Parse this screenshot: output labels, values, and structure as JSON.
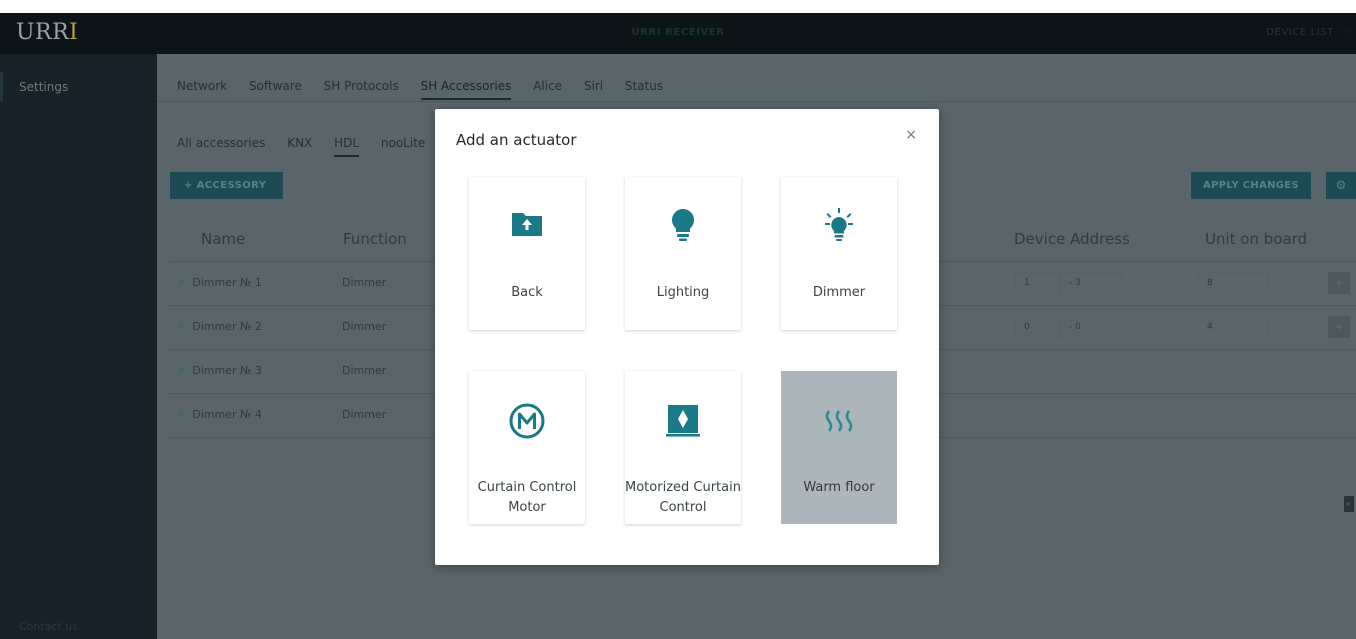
{
  "app": {
    "logo_main": "URR",
    "logo_accent": "I",
    "header_title": "URRI RECEIVER",
    "device_list_label": "DEVICE LIST",
    "device_list_caret": "⌵"
  },
  "sidebar": {
    "items": [
      {
        "label": "Settings"
      }
    ],
    "contact": "Contact us"
  },
  "tabs": [
    {
      "label": "Network"
    },
    {
      "label": "Software"
    },
    {
      "label": "SH Protocols"
    },
    {
      "label": "SH Accessories",
      "active": true
    },
    {
      "label": "Alice"
    },
    {
      "label": "Siri"
    },
    {
      "label": "Status"
    }
  ],
  "subtabs": [
    {
      "label": "All accessories"
    },
    {
      "label": "KNX"
    },
    {
      "label": "HDL",
      "active": true
    },
    {
      "label": "nooLite"
    }
  ],
  "toolbar": {
    "accessory_label": "+  ACCESSORY",
    "apply_label": "APPLY CHANGES",
    "gear_glyph": "⚙"
  },
  "table": {
    "headers": [
      "Name",
      "Function",
      "Device Address",
      "Unit on board"
    ],
    "rows": [
      {
        "name": "Dimmer № 1",
        "function": "Dimmer",
        "addr1": "1",
        "addr2": "3",
        "unit": "8"
      },
      {
        "name": "Dimmer № 2",
        "function": "Dimmer",
        "addr1": "0",
        "addr2": "0",
        "unit": "4"
      },
      {
        "name": "Dimmer № 3",
        "function": "Dimmer"
      },
      {
        "name": "Dimmer № 4",
        "function": "Dimmer"
      }
    ]
  },
  "modal": {
    "title": "Add an actuator",
    "close_glyph": "×",
    "cards": [
      {
        "label": "Back",
        "icon": "folder-upload-icon"
      },
      {
        "label": "Lighting",
        "icon": "bulb-icon"
      },
      {
        "label": "Dimmer",
        "icon": "bulb-rays-icon"
      },
      {
        "label": "Curtain Control Motor",
        "icon": "motor-m-icon"
      },
      {
        "label": "Motorized Curtain Control",
        "icon": "curtain-diamond-icon"
      },
      {
        "label": "Warm floor",
        "icon": "heat-waves-icon",
        "highlighted": true
      }
    ]
  },
  "colors": {
    "accent": "#1b7a87",
    "highlight_card": "#acb6ba",
    "header_bg": "#0c1418"
  }
}
